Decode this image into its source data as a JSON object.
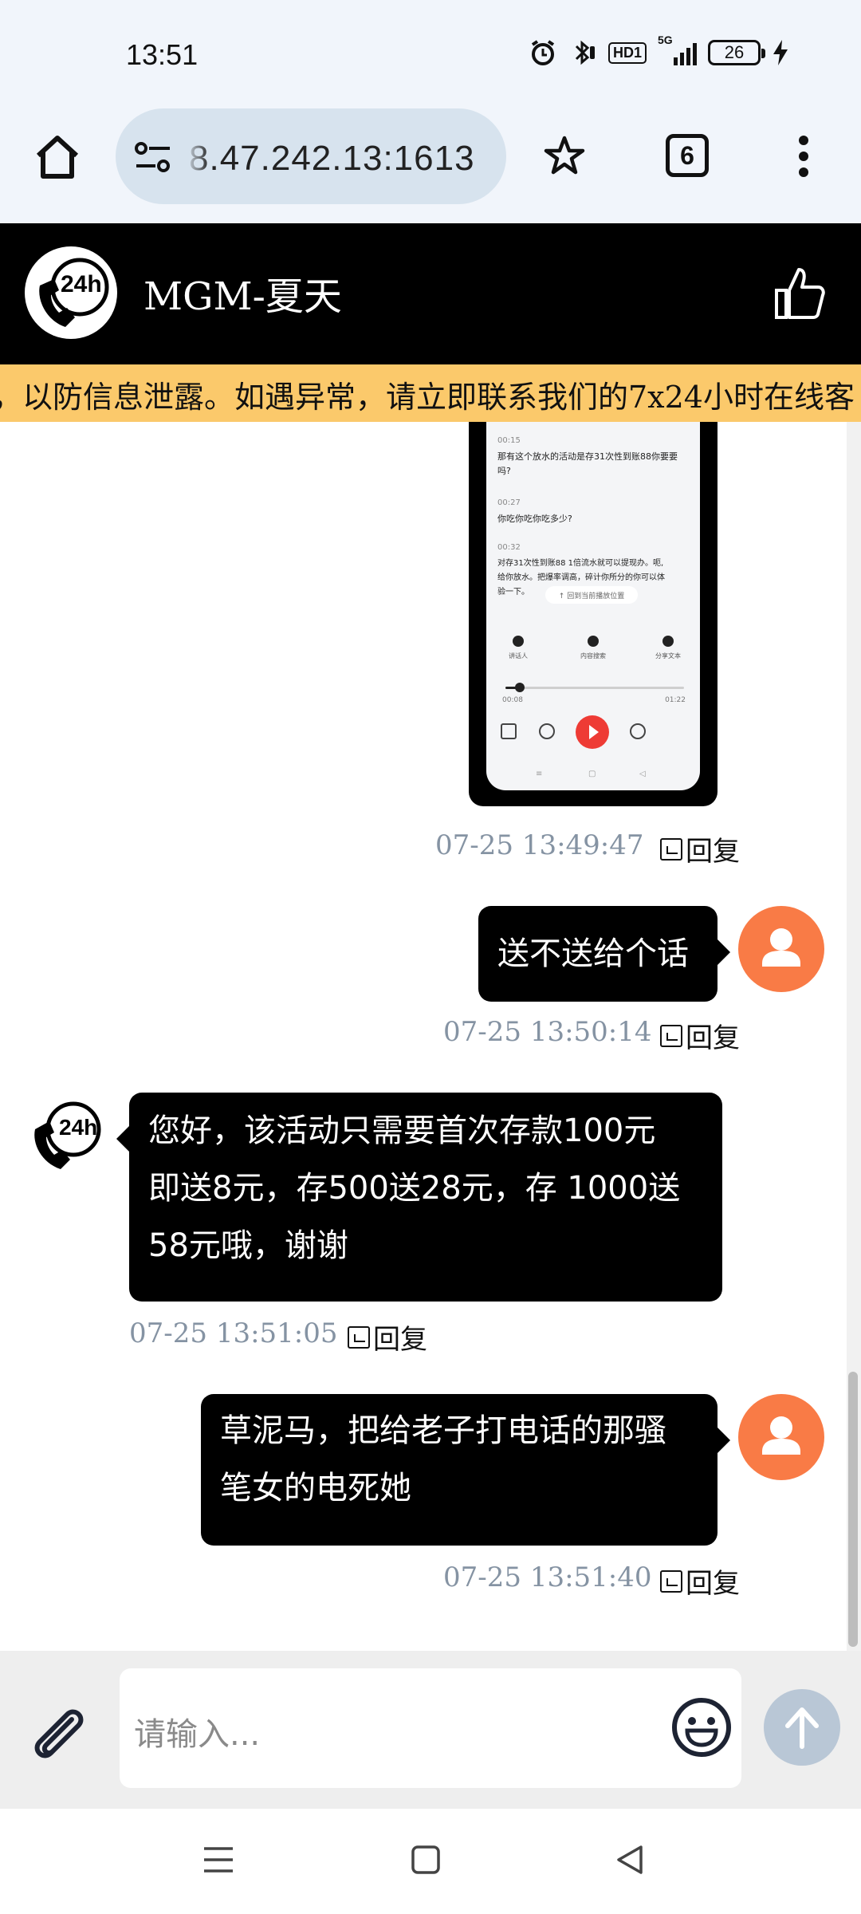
{
  "status_bar": {
    "time": "13:51",
    "network_label": "5G",
    "hd_label": "HD1",
    "battery_level": "26"
  },
  "browser": {
    "url": "8.47.242.13:1613",
    "tab_count": "6"
  },
  "header": {
    "title": "MGM-夏天",
    "logo_text": "24h"
  },
  "notice": {
    "text": "，以防信息泄露。如遇异常，请立即联系我们的7x24小时在线客"
  },
  "screenshot_image": {
    "transcript": [
      {
        "time": "00:15",
        "lines": [
          "那有这个放水的活动是存31次性到账88你要要",
          "吗?"
        ]
      },
      {
        "time": "00:27",
        "lines": [
          "你吃你吃你吃多少?"
        ]
      },
      {
        "time": "00:32",
        "lines": [
          "对存31次性到账88 1倍流水就可以提现办。呃,",
          "给你放水。把爆率调高，碎计你所分的你可以体",
          "验一下。"
        ]
      }
    ],
    "pill_text": "↑ 回到当前播放位置",
    "actions": [
      "讲话人",
      "内容搜索",
      "分享文本"
    ],
    "elapsed": "00:08",
    "duration": "01:22",
    "progress": 0.08
  },
  "messages": [
    {
      "side": "left-image",
      "timestamp": "07-25 13:49:47",
      "reply_label": "回复"
    },
    {
      "side": "right",
      "lines": [
        "送不送给个话"
      ],
      "timestamp": "07-25 13:50:14",
      "reply_label": "回复"
    },
    {
      "side": "left",
      "lines": [
        "您好，该活动只需要首次存款100元",
        "即送8元，存500送28元，存 1000送",
        "58元哦，谢谢"
      ],
      "timestamp": "07-25 13:51:05",
      "reply_label": "回复"
    },
    {
      "side": "right",
      "lines": [
        "草泥马，把给老子打电话的那骚",
        "笔女的电死她"
      ],
      "timestamp": "07-25 13:51:40",
      "reply_label": "回复"
    }
  ],
  "composer": {
    "placeholder": "请输入..."
  },
  "colors": {
    "header_bg": "#000000",
    "notice_bg": "#fbc96b",
    "user_avatar": "#f97b46",
    "send_button": "#b9c7d6",
    "timestamp": "#8593a3",
    "url_pill": "#d7e3ee"
  },
  "icons": [
    "home-icon",
    "site-settings-icon",
    "star-icon",
    "tabs-icon",
    "menu-icon",
    "thumbs-up-icon",
    "phone-24h-icon",
    "user-icon",
    "reply-icon",
    "paperclip-icon",
    "emoji-icon",
    "arrow-up-icon",
    "nav-menu-icon",
    "nav-home-icon",
    "nav-back-icon"
  ]
}
